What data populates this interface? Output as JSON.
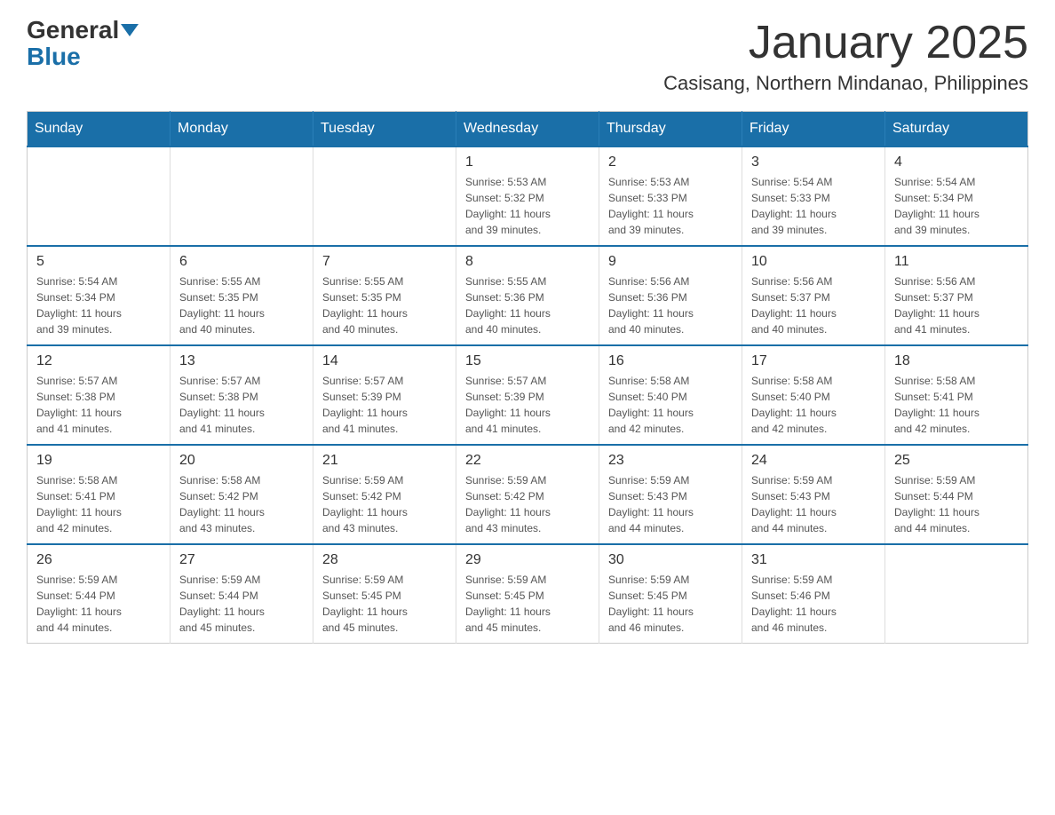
{
  "logo": {
    "general": "General",
    "blue": "Blue"
  },
  "header": {
    "title": "January 2025",
    "subtitle": "Casisang, Northern Mindanao, Philippines"
  },
  "weekdays": [
    "Sunday",
    "Monday",
    "Tuesday",
    "Wednesday",
    "Thursday",
    "Friday",
    "Saturday"
  ],
  "weeks": [
    [
      {
        "day": "",
        "info": ""
      },
      {
        "day": "",
        "info": ""
      },
      {
        "day": "",
        "info": ""
      },
      {
        "day": "1",
        "info": "Sunrise: 5:53 AM\nSunset: 5:32 PM\nDaylight: 11 hours\nand 39 minutes."
      },
      {
        "day": "2",
        "info": "Sunrise: 5:53 AM\nSunset: 5:33 PM\nDaylight: 11 hours\nand 39 minutes."
      },
      {
        "day": "3",
        "info": "Sunrise: 5:54 AM\nSunset: 5:33 PM\nDaylight: 11 hours\nand 39 minutes."
      },
      {
        "day": "4",
        "info": "Sunrise: 5:54 AM\nSunset: 5:34 PM\nDaylight: 11 hours\nand 39 minutes."
      }
    ],
    [
      {
        "day": "5",
        "info": "Sunrise: 5:54 AM\nSunset: 5:34 PM\nDaylight: 11 hours\nand 39 minutes."
      },
      {
        "day": "6",
        "info": "Sunrise: 5:55 AM\nSunset: 5:35 PM\nDaylight: 11 hours\nand 40 minutes."
      },
      {
        "day": "7",
        "info": "Sunrise: 5:55 AM\nSunset: 5:35 PM\nDaylight: 11 hours\nand 40 minutes."
      },
      {
        "day": "8",
        "info": "Sunrise: 5:55 AM\nSunset: 5:36 PM\nDaylight: 11 hours\nand 40 minutes."
      },
      {
        "day": "9",
        "info": "Sunrise: 5:56 AM\nSunset: 5:36 PM\nDaylight: 11 hours\nand 40 minutes."
      },
      {
        "day": "10",
        "info": "Sunrise: 5:56 AM\nSunset: 5:37 PM\nDaylight: 11 hours\nand 40 minutes."
      },
      {
        "day": "11",
        "info": "Sunrise: 5:56 AM\nSunset: 5:37 PM\nDaylight: 11 hours\nand 41 minutes."
      }
    ],
    [
      {
        "day": "12",
        "info": "Sunrise: 5:57 AM\nSunset: 5:38 PM\nDaylight: 11 hours\nand 41 minutes."
      },
      {
        "day": "13",
        "info": "Sunrise: 5:57 AM\nSunset: 5:38 PM\nDaylight: 11 hours\nand 41 minutes."
      },
      {
        "day": "14",
        "info": "Sunrise: 5:57 AM\nSunset: 5:39 PM\nDaylight: 11 hours\nand 41 minutes."
      },
      {
        "day": "15",
        "info": "Sunrise: 5:57 AM\nSunset: 5:39 PM\nDaylight: 11 hours\nand 41 minutes."
      },
      {
        "day": "16",
        "info": "Sunrise: 5:58 AM\nSunset: 5:40 PM\nDaylight: 11 hours\nand 42 minutes."
      },
      {
        "day": "17",
        "info": "Sunrise: 5:58 AM\nSunset: 5:40 PM\nDaylight: 11 hours\nand 42 minutes."
      },
      {
        "day": "18",
        "info": "Sunrise: 5:58 AM\nSunset: 5:41 PM\nDaylight: 11 hours\nand 42 minutes."
      }
    ],
    [
      {
        "day": "19",
        "info": "Sunrise: 5:58 AM\nSunset: 5:41 PM\nDaylight: 11 hours\nand 42 minutes."
      },
      {
        "day": "20",
        "info": "Sunrise: 5:58 AM\nSunset: 5:42 PM\nDaylight: 11 hours\nand 43 minutes."
      },
      {
        "day": "21",
        "info": "Sunrise: 5:59 AM\nSunset: 5:42 PM\nDaylight: 11 hours\nand 43 minutes."
      },
      {
        "day": "22",
        "info": "Sunrise: 5:59 AM\nSunset: 5:42 PM\nDaylight: 11 hours\nand 43 minutes."
      },
      {
        "day": "23",
        "info": "Sunrise: 5:59 AM\nSunset: 5:43 PM\nDaylight: 11 hours\nand 44 minutes."
      },
      {
        "day": "24",
        "info": "Sunrise: 5:59 AM\nSunset: 5:43 PM\nDaylight: 11 hours\nand 44 minutes."
      },
      {
        "day": "25",
        "info": "Sunrise: 5:59 AM\nSunset: 5:44 PM\nDaylight: 11 hours\nand 44 minutes."
      }
    ],
    [
      {
        "day": "26",
        "info": "Sunrise: 5:59 AM\nSunset: 5:44 PM\nDaylight: 11 hours\nand 44 minutes."
      },
      {
        "day": "27",
        "info": "Sunrise: 5:59 AM\nSunset: 5:44 PM\nDaylight: 11 hours\nand 45 minutes."
      },
      {
        "day": "28",
        "info": "Sunrise: 5:59 AM\nSunset: 5:45 PM\nDaylight: 11 hours\nand 45 minutes."
      },
      {
        "day": "29",
        "info": "Sunrise: 5:59 AM\nSunset: 5:45 PM\nDaylight: 11 hours\nand 45 minutes."
      },
      {
        "day": "30",
        "info": "Sunrise: 5:59 AM\nSunset: 5:45 PM\nDaylight: 11 hours\nand 46 minutes."
      },
      {
        "day": "31",
        "info": "Sunrise: 5:59 AM\nSunset: 5:46 PM\nDaylight: 11 hours\nand 46 minutes."
      },
      {
        "day": "",
        "info": ""
      }
    ]
  ]
}
